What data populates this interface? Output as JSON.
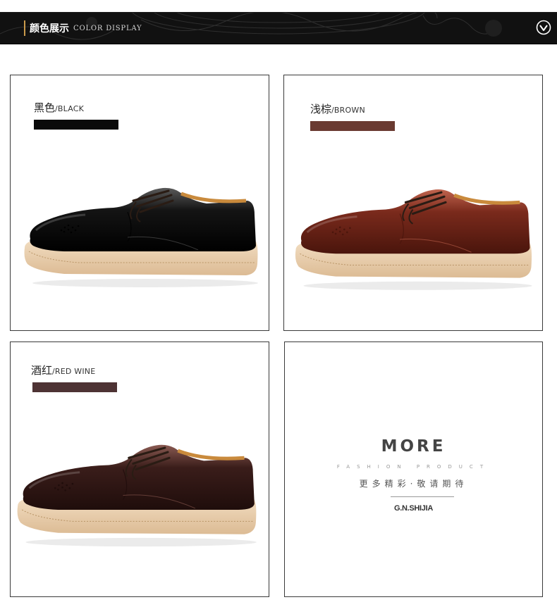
{
  "header": {
    "title_cn": "颜色展示",
    "title_en": "COLOR DISPLAY",
    "background": "#111111",
    "accent": "#c99a4b",
    "dropdown_icon": "chevron-down-circle-icon"
  },
  "colors": [
    {
      "label_cn": "黑色",
      "label_en": "/BLACK",
      "swatch": "#0a0a0a",
      "shoe_upper": "#141414",
      "shoe_shade": "#000000",
      "shoe_highlight": "#5a5a5a"
    },
    {
      "label_cn": "浅棕",
      "label_en": "/BROWN",
      "swatch": "#6a3a31",
      "shoe_upper": "#7a2a1c",
      "shoe_shade": "#4a150c",
      "shoe_highlight": "#c0644e"
    },
    {
      "label_cn": "酒红",
      "label_en": "/RED WINE",
      "swatch": "#4e3334",
      "shoe_upper": "#3a1d1a",
      "shoe_shade": "#1f0d0b",
      "shoe_highlight": "#8a5a52"
    }
  ],
  "more": {
    "title": "MORE",
    "subtitle": "FASHION PRODUCT",
    "tagline_cn": "更多精彩·敬请期待",
    "brand": "G.N.SHIJIA"
  }
}
